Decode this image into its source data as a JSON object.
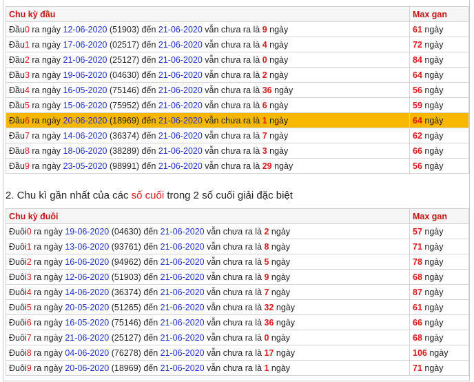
{
  "table1": {
    "header": {
      "col1": "Chu kỳ đầu",
      "col2": "Max gan"
    },
    "label": "Đầu",
    "rows": [
      {
        "digit": "0",
        "start": "12-06-2020",
        "code": "(51903)",
        "end": "21-06-2020",
        "count": "9",
        "max": "61"
      },
      {
        "digit": "1",
        "start": "17-06-2020",
        "code": "(02517)",
        "end": "21-06-2020",
        "count": "4",
        "max": "72"
      },
      {
        "digit": "2",
        "start": "21-06-2020",
        "code": "(25127)",
        "end": "21-06-2020",
        "count": "0",
        "max": "84"
      },
      {
        "digit": "3",
        "start": "19-06-2020",
        "code": "(04630)",
        "end": "21-06-2020",
        "count": "2",
        "max": "64"
      },
      {
        "digit": "4",
        "start": "16-05-2020",
        "code": "(75146)",
        "end": "21-06-2020",
        "count": "36",
        "max": "56"
      },
      {
        "digit": "5",
        "start": "15-06-2020",
        "code": "(75952)",
        "end": "21-06-2020",
        "count": "6",
        "max": "59"
      },
      {
        "digit": "6",
        "start": "20-06-2020",
        "code": "(18969)",
        "end": "21-06-2020",
        "count": "1",
        "max": "64"
      },
      {
        "digit": "7",
        "start": "14-06-2020",
        "code": "(36374)",
        "end": "21-06-2020",
        "count": "7",
        "max": "62"
      },
      {
        "digit": "8",
        "start": "18-06-2020",
        "code": "(38289)",
        "end": "21-06-2020",
        "count": "3",
        "max": "66"
      },
      {
        "digit": "9",
        "start": "23-05-2020",
        "code": "(98991)",
        "end": "21-06-2020",
        "count": "29",
        "max": "56"
      }
    ]
  },
  "heading2": {
    "prefix": "2. Chu kì gần nhất của các ",
    "highlight": "số cuối",
    "suffix": " trong 2 số cuối giải đặc biệt"
  },
  "table2": {
    "header": {
      "col1": "Chu kỳ đuôi",
      "col2": "Max gan"
    },
    "label": "Đuôi",
    "rows": [
      {
        "digit": "0",
        "start": "19-06-2020",
        "code": "(04630)",
        "end": "21-06-2020",
        "count": "2",
        "max": "57"
      },
      {
        "digit": "1",
        "start": "13-06-2020",
        "code": "(93761)",
        "end": "21-06-2020",
        "count": "8",
        "max": "71"
      },
      {
        "digit": "2",
        "start": "16-06-2020",
        "code": "(94962)",
        "end": "21-06-2020",
        "count": "5",
        "max": "78"
      },
      {
        "digit": "3",
        "start": "12-06-2020",
        "code": "(51903)",
        "end": "21-06-2020",
        "count": "9",
        "max": "68"
      },
      {
        "digit": "4",
        "start": "14-06-2020",
        "code": "(36374)",
        "end": "21-06-2020",
        "count": "7",
        "max": "87"
      },
      {
        "digit": "5",
        "start": "20-05-2020",
        "code": "(51265)",
        "end": "21-06-2020",
        "count": "32",
        "max": "61"
      },
      {
        "digit": "6",
        "start": "16-05-2020",
        "code": "(75146)",
        "end": "21-06-2020",
        "count": "36",
        "max": "66"
      },
      {
        "digit": "7",
        "start": "21-06-2020",
        "code": "(25127)",
        "end": "21-06-2020",
        "count": "0",
        "max": "68"
      },
      {
        "digit": "8",
        "start": "04-06-2020",
        "code": "(76278)",
        "end": "21-06-2020",
        "count": "17",
        "max": "106"
      },
      {
        "digit": "9",
        "start": "20-06-2020",
        "code": "(18969)",
        "end": "21-06-2020",
        "count": "1",
        "max": "71"
      }
    ]
  },
  "text": {
    "ra_ngay": " ra ngày ",
    "den": " đến ",
    "van_chua": " vẫn chưa ra là ",
    "ngay": " ngày"
  },
  "highlight_row_table1": 6,
  "colors": {
    "highlight_bg": "#f8b800",
    "header_text": "#c41414",
    "date": "#1a2fd6",
    "number": "#e01818"
  }
}
